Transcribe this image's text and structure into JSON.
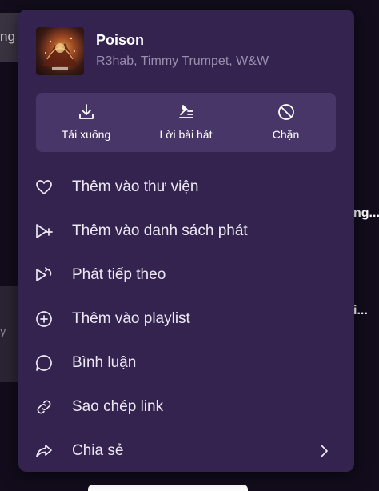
{
  "background": {
    "left_top_fragment": "ng",
    "right_fragments": [
      "ng...",
      "i..."
    ]
  },
  "track": {
    "title": "Poison",
    "artists": "R3hab, Timmy Trumpet, W&W"
  },
  "actions": [
    {
      "label": "Tải xuống",
      "icon": "download-icon"
    },
    {
      "label": "Lời bài hát",
      "icon": "lyrics-icon"
    },
    {
      "label": "Chặn",
      "icon": "block-icon"
    }
  ],
  "menu_items": [
    {
      "label": "Thêm vào thư viện",
      "icon": "heart-icon"
    },
    {
      "label": "Thêm vào danh sách phát",
      "icon": "play-next-add-icon"
    },
    {
      "label": "Phát tiếp theo",
      "icon": "play-next-icon"
    },
    {
      "label": "Thêm vào playlist",
      "icon": "plus-circle-icon"
    },
    {
      "label": "Bình luận",
      "icon": "comment-icon"
    },
    {
      "label": "Sao chép link",
      "icon": "link-icon"
    },
    {
      "label": "Chia sẻ",
      "icon": "share-icon"
    }
  ],
  "colors": {
    "menu_bg": "#34224f",
    "action_box_bg": "#493668",
    "text_primary": "#ffffff",
    "text_secondary": "#9b8fb0"
  }
}
